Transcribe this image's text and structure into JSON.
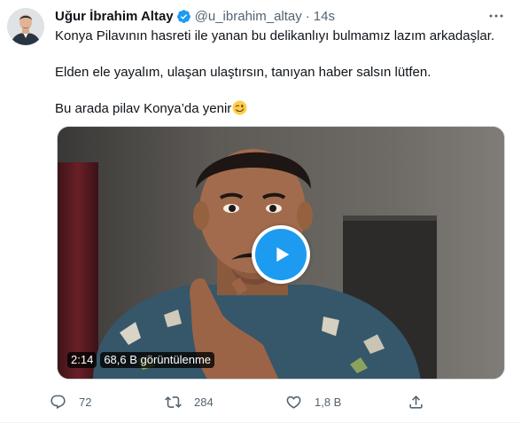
{
  "colors": {
    "accent": "#1d9bf0",
    "secondary_text": "#536471",
    "primary_text": "#0f1419"
  },
  "author": {
    "display_name": "Uğur İbrahim Altay",
    "handle": "@u_ibrahim_altay",
    "separator": "·",
    "time": "14s",
    "verified_icon": "verified-badge-icon"
  },
  "tweet": {
    "line1": "Konya Pilavının hasreti ile yanan bu delikanlıyı bulmamız lazım arkadaşlar.",
    "line2": "Elden ele yayalım, ulaşan ulaştırsın, tanıyan haber salsın lütfen.",
    "line3": "Bu arada pilav Konya’da yenir",
    "emoji": "winking-face-icon"
  },
  "video": {
    "duration": "2:14",
    "views": "68,6 B görüntülenme",
    "play_icon": "play-icon"
  },
  "actions": {
    "reply_count": "72",
    "retweet_count": "284",
    "like_count": "1,8 B",
    "share_icon": "share-icon"
  }
}
